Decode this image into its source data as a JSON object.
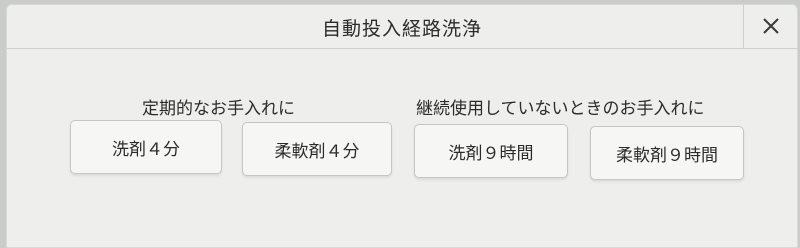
{
  "dialog": {
    "title": "自動投入経路洗浄",
    "close_icon": "close-icon"
  },
  "sections": {
    "regular": {
      "label": "定期的なお手入れに",
      "buttons": [
        "洗剤４分",
        "柔軟剤４分"
      ]
    },
    "unused": {
      "label": "継続使用していないときのお手入れに",
      "buttons": [
        "洗剤９時間",
        "柔軟剤９時間"
      ]
    }
  }
}
